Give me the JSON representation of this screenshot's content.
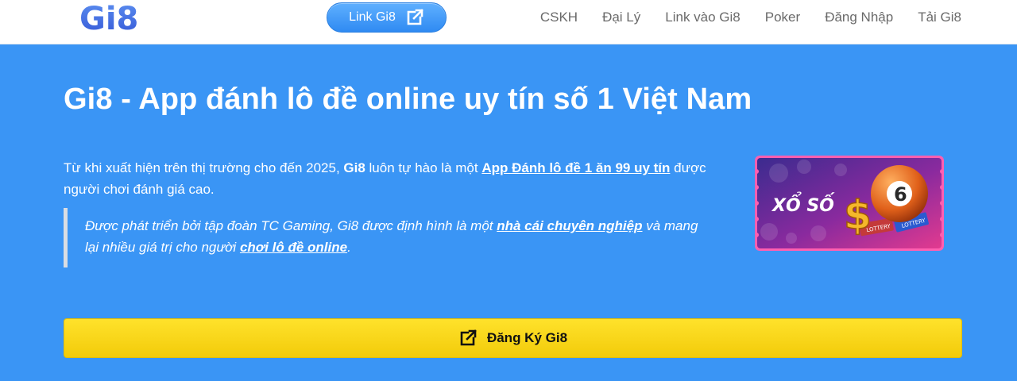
{
  "header": {
    "logo_text": "Gi8",
    "cta_label": "Link Gi8",
    "cta_icon": "external-link-icon",
    "nav": [
      "CSKH",
      "Đại Lý",
      "Link vào Gi8",
      "Poker",
      "Đăng Nhập",
      "Tải Gi8"
    ]
  },
  "hero": {
    "title": "Gi8 - App đánh lô đề online uy tín số 1 Việt Nam",
    "intro": {
      "text1": "Từ khi xuất hiện trên thị trường cho đến 2025, ",
      "brand": "Gi8",
      "text2": " luôn tự hào là một ",
      "link": "App Đánh lô đề 1 ăn 99 uy tín",
      "text3": " được người chơi đánh giá cao."
    },
    "quote": {
      "text1": "Được phát triển bởi tập đoàn TC Gaming, Gi8 được định hình là một ",
      "link1": "nhà cái chuyên nghiệp",
      "text2": " và mang lại nhiều giá trị cho người ",
      "link2": "chơi lô đề online",
      "text3": "."
    },
    "promo_image": {
      "caption": "XỔ SỐ",
      "ball_number": "6",
      "ticket_text": "LOTTERY",
      "accent_colors": [
        "#e23a8f",
        "#ff4da6",
        "#3a2a8f"
      ]
    },
    "register_label": "Đăng Ký Gi8",
    "register_icon": "external-link-icon"
  },
  "colors": {
    "background": "#3a95f5",
    "header_bg": "#ffffff",
    "nav_text": "#6a6a6a",
    "cta_pill": "#3d97f7",
    "register_button": "#f7d417",
    "logo": "#3d6fe0"
  }
}
